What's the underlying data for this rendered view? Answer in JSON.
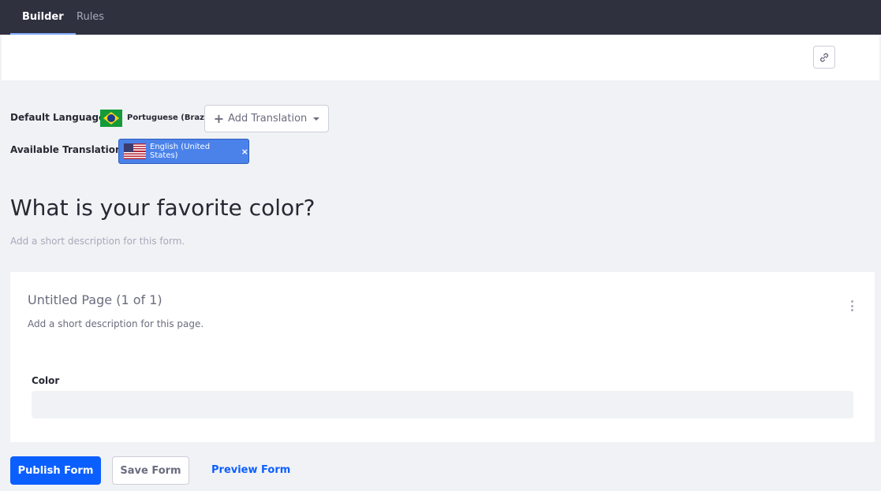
{
  "nav": {
    "tabs": [
      {
        "label": "Builder",
        "active": true
      },
      {
        "label": "Rules",
        "active": false
      }
    ]
  },
  "toolbar": {
    "share_icon": "link-icon"
  },
  "translations": {
    "default_label": "Default Language:",
    "default_language": "Portuguese (Brazil)",
    "default_flag": "flag-brazil-icon",
    "add_translation_label": "Add Translation",
    "available_label": "Available Translations:",
    "available": [
      {
        "label": "English (United States)",
        "flag": "flag-us-icon"
      }
    ]
  },
  "form": {
    "title": "What is your favorite color?",
    "description_placeholder": "Add a short description for this form."
  },
  "page": {
    "title": "Untitled Page (1 of 1)",
    "description_placeholder": "Add a short description for this page.",
    "field": {
      "label": "Color",
      "value": ""
    }
  },
  "actions": {
    "publish": "Publish Form",
    "save": "Save Form",
    "preview": "Preview Form"
  },
  "colors": {
    "nav_bg": "#30313f",
    "primary": "#0b5fff",
    "chip_bg": "#4b82ea",
    "page_bg": "#f1f2f5"
  }
}
